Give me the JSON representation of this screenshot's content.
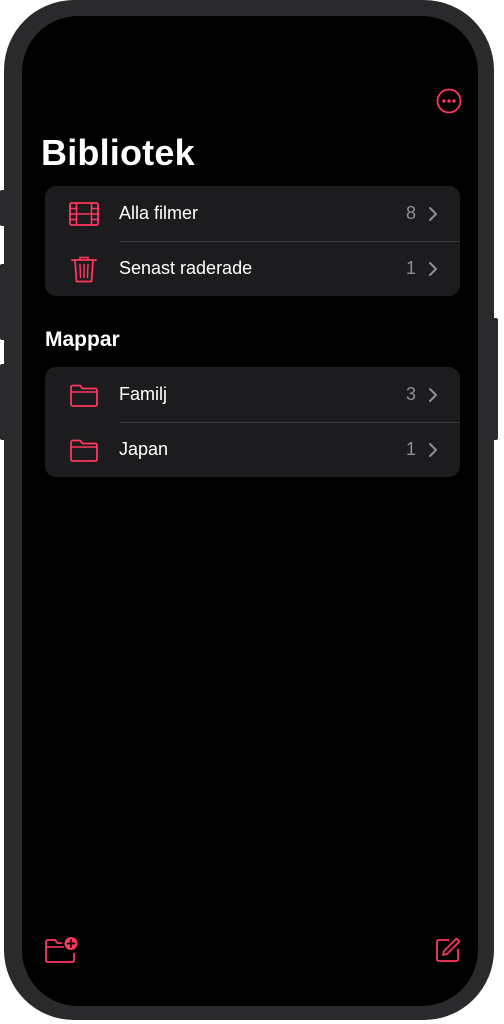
{
  "colors": {
    "accent": "#ff375f",
    "row_background": "#1c1c1e",
    "screen_background": "#000000",
    "secondary_text": "#8e8e93"
  },
  "header": {
    "more_icon": "ellipsis-circle-icon",
    "title": "Bibliotek"
  },
  "library": {
    "items": [
      {
        "label": "Alla filmer",
        "count": "8",
        "icon": "film-icon"
      },
      {
        "label": "Senast raderade",
        "count": "1",
        "icon": "trash-icon"
      }
    ]
  },
  "folders": {
    "title": "Mappar",
    "items": [
      {
        "label": "Familj",
        "count": "3",
        "icon": "folder-icon"
      },
      {
        "label": "Japan",
        "count": "1",
        "icon": "folder-icon"
      }
    ]
  },
  "toolbar": {
    "left_icon": "new-folder-icon",
    "right_icon": "compose-icon"
  }
}
